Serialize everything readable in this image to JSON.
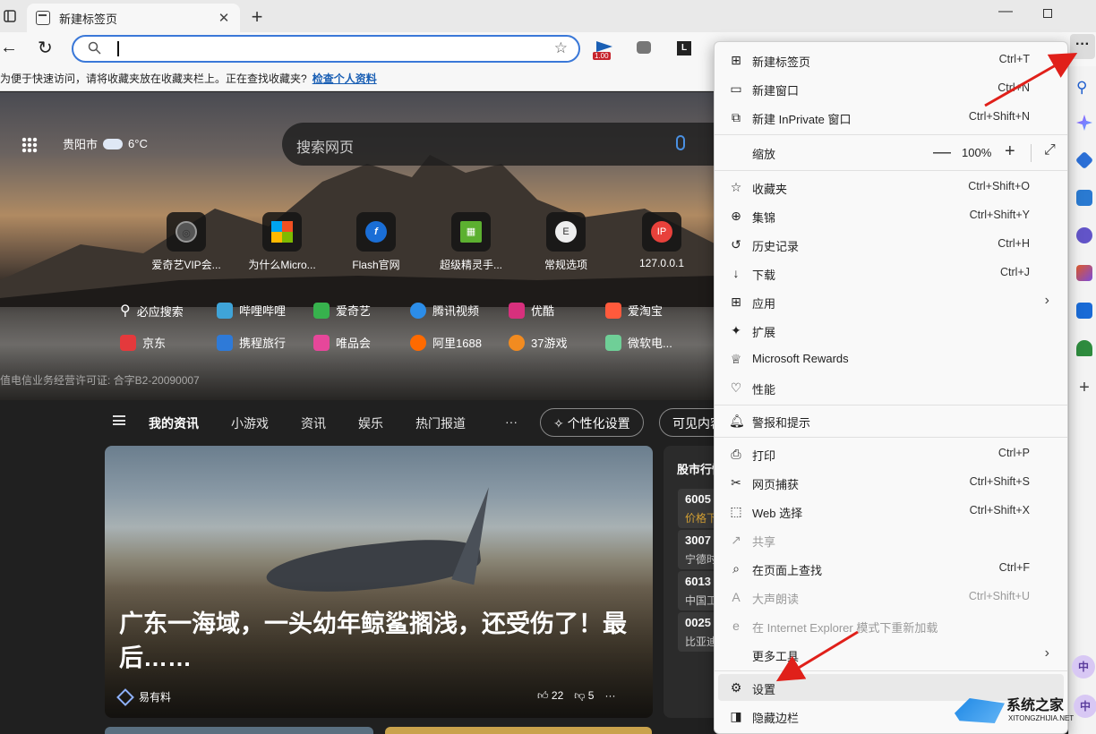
{
  "browser": {
    "tab_title": "新建标签页",
    "tab_close": "✕",
    "new_tab": "+",
    "minimize": "—",
    "more_button": "···"
  },
  "toolbar": {
    "back": "←",
    "reload": "↻",
    "address_value": "",
    "extensions": [
      {
        "name": "play-extension",
        "badge": "1.00"
      },
      {
        "name": "game-extension"
      },
      {
        "name": "l-extension",
        "label": "L"
      }
    ]
  },
  "favbar": {
    "message": "为便于快速访问，请将收藏夹放在收藏夹栏上。正在查找收藏夹?",
    "link": "检查个人资料"
  },
  "hero": {
    "weather_city": "贵阳市",
    "weather_temp": "6°C",
    "search_placeholder": "搜索网页",
    "quick_links": [
      {
        "label": "爱奇艺VIP会...",
        "glyph": "◎"
      },
      {
        "label": "为什么Micro...",
        "glyph": ""
      },
      {
        "label": "Flash官网",
        "glyph": "f"
      },
      {
        "label": "超级精灵手...",
        "glyph": "▦"
      },
      {
        "label": "常规选项",
        "glyph": "E"
      },
      {
        "label": "127.0.0.1",
        "glyph": "IP"
      }
    ],
    "site_links_row1": [
      {
        "label": "必应搜索",
        "color": ""
      },
      {
        "label": "哔哩哔哩",
        "color": "#3fa4d8"
      },
      {
        "label": "爱奇艺",
        "color": "#37b24d"
      },
      {
        "label": "腾讯视频",
        "color": "#2c8de8"
      },
      {
        "label": "优酷",
        "color": "#d7307d"
      },
      {
        "label": "爱淘宝",
        "color": "#ff5a3c"
      }
    ],
    "site_links_row2": [
      {
        "label": "京东",
        "color": "#e4393c"
      },
      {
        "label": "携程旅行",
        "color": "#2e7ad8"
      },
      {
        "label": "唯品会",
        "color": "#e6479a"
      },
      {
        "label": "阿里1688",
        "color": "#ff6a00"
      },
      {
        "label": "37游戏",
        "color": "#f28b20"
      },
      {
        "label": "微软电...",
        "color": "#6fcf97"
      }
    ],
    "license": "值电信业务经营许可证: 合字B2-20090007"
  },
  "news_nav": {
    "items": [
      "我的资讯",
      "小游戏",
      "资讯",
      "娱乐",
      "热门报道"
    ],
    "more": "···",
    "personalize": "个性化设置",
    "visible_content": "可见内容"
  },
  "news_card": {
    "headline": "广东一海域，一头幼年鲸鲨搁浅，还受伤了！最后……",
    "source": "易有料",
    "likes": "22",
    "dislikes": "5",
    "more": "···"
  },
  "stocks": {
    "title": "股市行情",
    "rows": [
      {
        "code": "6005",
        "name": "价格下"
      },
      {
        "code": "3007",
        "name": "宁德时"
      },
      {
        "code": "6013",
        "name": "中国工"
      },
      {
        "code": "0025",
        "name": "比亚迪"
      }
    ]
  },
  "menu": {
    "new_tab": {
      "label": "新建标签页",
      "shortcut": "Ctrl+T"
    },
    "new_window": {
      "label": "新建窗口",
      "shortcut": "Ctrl+N"
    },
    "new_inprivate": {
      "label": "新建 InPrivate 窗口",
      "shortcut": "Ctrl+Shift+N"
    },
    "zoom": {
      "label": "缩放",
      "value": "100%",
      "minus": "—",
      "plus": "+",
      "fullscreen": "⤢"
    },
    "favorites": {
      "label": "收藏夹",
      "shortcut": "Ctrl+Shift+O"
    },
    "collections": {
      "label": "集锦",
      "shortcut": "Ctrl+Shift+Y"
    },
    "history": {
      "label": "历史记录",
      "shortcut": "Ctrl+H"
    },
    "downloads": {
      "label": "下载",
      "shortcut": "Ctrl+J"
    },
    "apps": {
      "label": "应用",
      "chevron": "›"
    },
    "extensions": {
      "label": "扩展"
    },
    "rewards": {
      "label": "Microsoft Rewards"
    },
    "performance": {
      "label": "性能"
    },
    "alerts": {
      "label": "警报和提示"
    },
    "print": {
      "label": "打印",
      "shortcut": "Ctrl+P"
    },
    "web_capture": {
      "label": "网页捕获",
      "shortcut": "Ctrl+Shift+S"
    },
    "web_select": {
      "label": "Web 选择",
      "shortcut": "Ctrl+Shift+X"
    },
    "share": {
      "label": "共享"
    },
    "find": {
      "label": "在页面上查找",
      "shortcut": "Ctrl+F"
    },
    "read_aloud": {
      "label": "大声朗读",
      "shortcut": "Ctrl+Shift+U"
    },
    "ie_mode": {
      "label": "在 Internet Explorer 模式下重新加载"
    },
    "more_tools": {
      "label": "更多工具",
      "chevron": "›"
    },
    "settings": {
      "label": "设置"
    },
    "hide_sidebar": {
      "label": "隐藏边栏"
    }
  },
  "ime": {
    "label": "中"
  },
  "watermark": {
    "name": "系统之家",
    "url": "XITONGZHIJIA.NET"
  },
  "colors": {
    "accent": "#3a78d8",
    "arrow": "#e0201a",
    "menu_bg": "#f9f9f9"
  }
}
